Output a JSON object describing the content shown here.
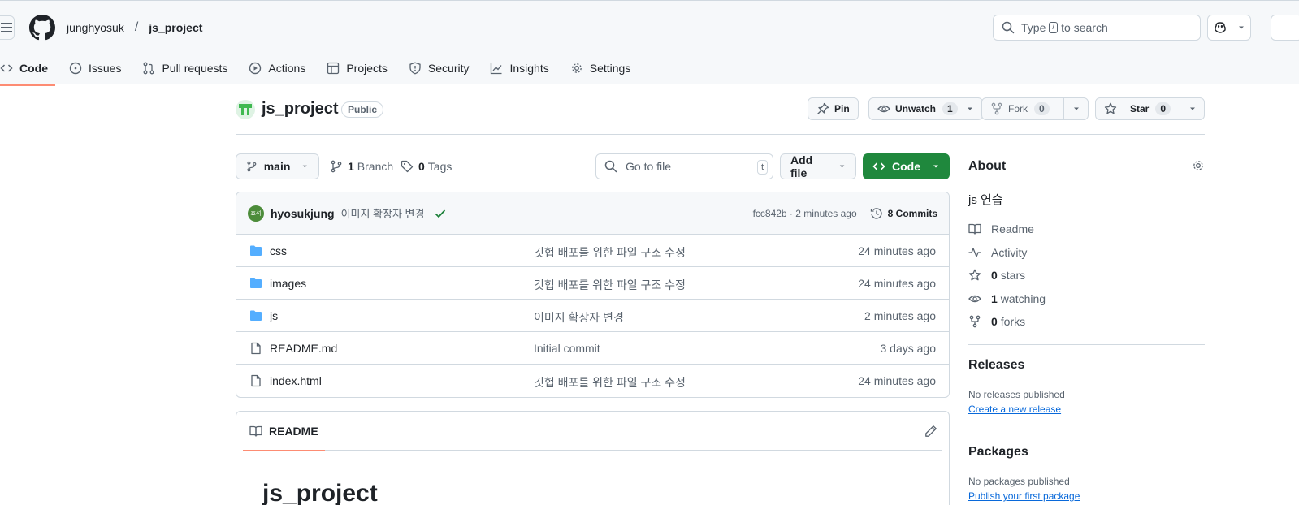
{
  "header": {
    "owner": "junghyosuk",
    "separator": "/",
    "repo": "js_project",
    "search_prefix": "Type",
    "search_key": "/",
    "search_suffix": "to search"
  },
  "tabs": [
    {
      "label": "Code",
      "icon": "code-icon"
    },
    {
      "label": "Issues",
      "icon": "issue-icon"
    },
    {
      "label": "Pull requests",
      "icon": "pull-request-icon"
    },
    {
      "label": "Actions",
      "icon": "play-icon"
    },
    {
      "label": "Projects",
      "icon": "table-icon"
    },
    {
      "label": "Security",
      "icon": "shield-icon"
    },
    {
      "label": "Insights",
      "icon": "graph-icon"
    },
    {
      "label": "Settings",
      "icon": "gear-icon"
    }
  ],
  "repo_head": {
    "name": "js_project",
    "visibility": "Public",
    "pin_label": "Pin",
    "unwatch_label": "Unwatch",
    "watch_count": "1",
    "fork_label": "Fork",
    "fork_count": "0",
    "star_label": "Star",
    "star_count": "0"
  },
  "toolbar": {
    "branch": "main",
    "branch_count": "1",
    "branch_label": "Branch",
    "tag_count": "0",
    "tag_label": "Tags",
    "goto_placeholder": "Go to file",
    "goto_key": "t",
    "add_file_label": "Add file",
    "code_label": "Code"
  },
  "latest_commit": {
    "avatar_text": "효석",
    "author": "hyosukjung",
    "message": "이미지 확장자 변경",
    "sha_time": "fcc842b · 2 minutes ago",
    "commits_label": "8 Commits"
  },
  "files": [
    {
      "type": "folder",
      "name": "css",
      "message": "깃헙 배포를 위한 파일 구조 수정",
      "time": "24 minutes ago"
    },
    {
      "type": "folder",
      "name": "images",
      "message": "깃헙 배포를 위한 파일 구조 수정",
      "time": "24 minutes ago"
    },
    {
      "type": "folder",
      "name": "js",
      "message": "이미지 확장자 변경",
      "time": "2 minutes ago"
    },
    {
      "type": "file",
      "name": "README.md",
      "message": "Initial commit",
      "time": "3 days ago"
    },
    {
      "type": "file",
      "name": "index.html",
      "message": "깃헙 배포를 위한 파일 구조 수정",
      "time": "24 minutes ago"
    }
  ],
  "readme": {
    "tab_label": "README",
    "title": "js_project"
  },
  "about": {
    "heading": "About",
    "description": "js 연습",
    "readme_label": "Readme",
    "activity_label": "Activity",
    "stars_count": "0",
    "stars_label": "stars",
    "watching_count": "1",
    "watching_label": "watching",
    "forks_count": "0",
    "forks_label": "forks"
  },
  "releases": {
    "heading": "Releases",
    "empty": "No releases published",
    "create_link": "Create a new release"
  },
  "packages": {
    "heading": "Packages",
    "empty": "No packages published",
    "publish_link": "Publish your first package"
  },
  "colors": {
    "accent_green": "#1f883d",
    "tab_underline": "#fd8c73",
    "folder_blue": "#54aeff",
    "link_blue": "#0969da"
  }
}
